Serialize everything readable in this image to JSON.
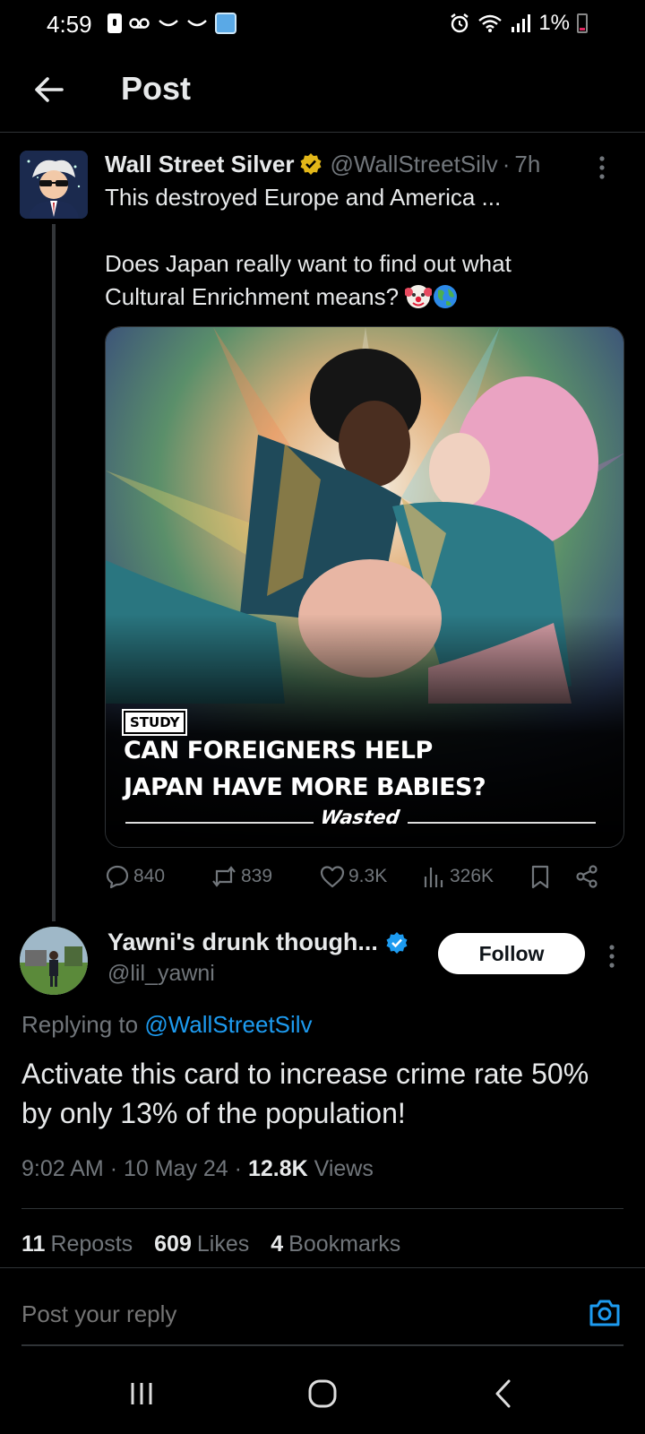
{
  "status_bar": {
    "time": "4:59",
    "battery_text": "1%",
    "left_icons": [
      "lock-notification-icon",
      "voicemail-icon",
      "voicemail-icon",
      "voicemail-icon",
      "app-notification-icon"
    ],
    "right_icons": [
      "alarm-icon",
      "wifi-icon",
      "signal-icon",
      "battery-low-icon"
    ]
  },
  "header": {
    "title": "Post",
    "back_icon": "arrow-left-icon"
  },
  "parent_post": {
    "author_name": "Wall Street Silver",
    "verified_badge": "gold-verified-icon",
    "handle": "@WallStreetSilv",
    "separator": "·",
    "time_ago": "7h",
    "text_lines": [
      "This destroyed Europe and America ...",
      "",
      "Does Japan really want to find out what",
      "Cultural Enrichment means?"
    ],
    "emojis": [
      "clown-face-emoji",
      "globe-emoji"
    ],
    "media": {
      "tag": "STUDY",
      "headline_line1": "CAN FOREIGNERS HELP",
      "headline_line2": "JAPAN HAVE MORE BABIES?",
      "brand": "Wasted"
    },
    "actions": {
      "replies": "840",
      "reposts": "839",
      "likes": "9.3K",
      "views": "326K"
    }
  },
  "reply_post": {
    "author_name": "Yawni's drunk though...",
    "verified_badge": "blue-verified-icon",
    "handle": "@lil_yawni",
    "follow_label": "Follow",
    "replying_prefix": "Replying to",
    "replying_to": "@WallStreetSilv",
    "text": "Activate this card to increase crime rate 50% by only 13% of the population!",
    "time": "9:02 AM",
    "date": "10 May 24",
    "views_count": "12.8K",
    "views_label": "Views",
    "separator": "·",
    "reposts_count": "11",
    "reposts_label": "Reposts",
    "likes_count": "609",
    "likes_label": "Likes",
    "bookmarks_count": "4",
    "bookmarks_label": "Bookmarks"
  },
  "composer": {
    "placeholder": "Post your reply",
    "camera_icon": "camera-icon"
  },
  "nav": {
    "icons": [
      "recents-icon",
      "home-icon",
      "back-icon"
    ]
  },
  "colors": {
    "background": "#000000",
    "text_primary": "#e7e9ea",
    "text_secondary": "#71767b",
    "accent_blue": "#1d9bf0",
    "gold_badge": "#e2b719",
    "divider": "#2f3336"
  }
}
